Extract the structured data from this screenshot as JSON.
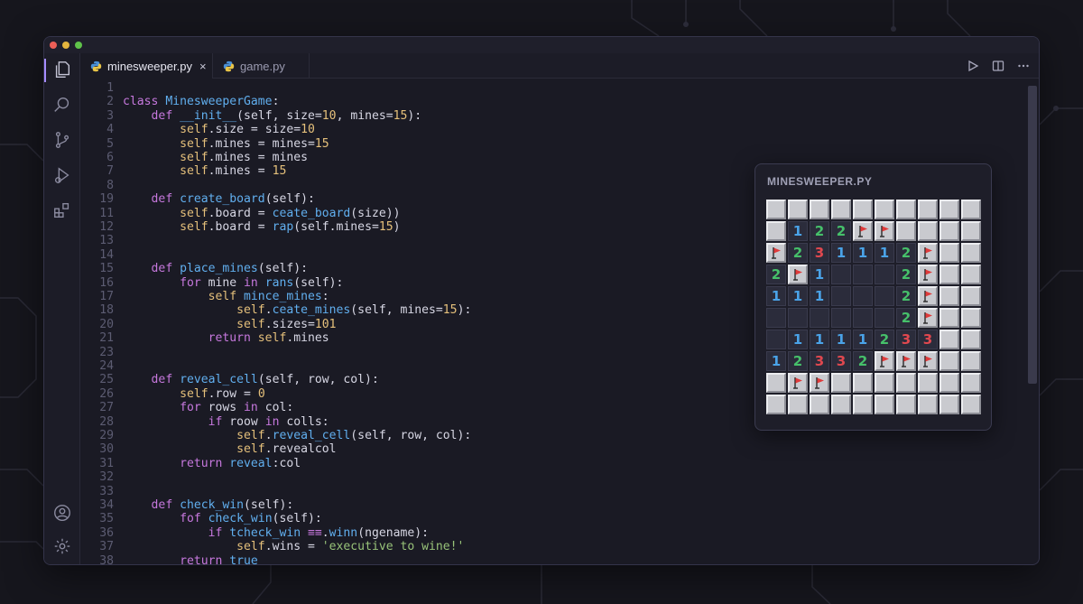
{
  "window": {
    "tabs": [
      {
        "label": "minesweeper.py",
        "active": true,
        "close": "×"
      },
      {
        "label": "game.py",
        "active": false
      }
    ],
    "tab_actions": [
      {
        "icon": "run-icon"
      },
      {
        "icon": "split-editor-icon"
      },
      {
        "icon": "more-icon"
      }
    ]
  },
  "activity_bar": {
    "top": [
      "explorer-icon",
      "search-icon",
      "source-control-icon",
      "run-debug-icon",
      "extensions-icon"
    ],
    "bottom": [
      "account-icon",
      "settings-gear-icon"
    ]
  },
  "editor": {
    "lines": [
      {
        "n": "1",
        "t": [
          {
            "c": "d",
            "s": ""
          }
        ]
      },
      {
        "n": "2",
        "t": [
          {
            "c": "k",
            "s": "class "
          },
          {
            "c": "f",
            "s": "MinesweeperGame"
          },
          {
            "c": "d",
            "s": ":"
          }
        ]
      },
      {
        "n": "3",
        "t": [
          {
            "c": "d",
            "s": "    "
          },
          {
            "c": "k",
            "s": "def "
          },
          {
            "c": "f",
            "s": "__init__"
          },
          {
            "c": "d",
            "s": "(self, size="
          },
          {
            "c": "n",
            "s": "10"
          },
          {
            "c": "d",
            "s": ", mines="
          },
          {
            "c": "n",
            "s": "15"
          },
          {
            "c": "d",
            "s": "):"
          }
        ]
      },
      {
        "n": "4",
        "t": [
          {
            "c": "d",
            "s": "        "
          },
          {
            "c": "y",
            "s": "self"
          },
          {
            "c": "d",
            "s": ".size = size="
          },
          {
            "c": "n",
            "s": "10"
          }
        ]
      },
      {
        "n": "5",
        "t": [
          {
            "c": "d",
            "s": "        "
          },
          {
            "c": "y",
            "s": "self"
          },
          {
            "c": "d",
            "s": ".mines = mines="
          },
          {
            "c": "n",
            "s": "15"
          }
        ]
      },
      {
        "n": "6",
        "t": [
          {
            "c": "d",
            "s": "        "
          },
          {
            "c": "y",
            "s": "self"
          },
          {
            "c": "d",
            "s": ".mines = mines"
          }
        ]
      },
      {
        "n": "7",
        "t": [
          {
            "c": "d",
            "s": "        "
          },
          {
            "c": "y",
            "s": "self"
          },
          {
            "c": "d",
            "s": ".mines = "
          },
          {
            "c": "n",
            "s": "15"
          }
        ]
      },
      {
        "n": "8",
        "t": [
          {
            "c": "d",
            "s": ""
          }
        ]
      },
      {
        "n": "19",
        "t": [
          {
            "c": "d",
            "s": "    "
          },
          {
            "c": "k",
            "s": "def "
          },
          {
            "c": "f",
            "s": "create_board"
          },
          {
            "c": "d",
            "s": "(self):"
          }
        ]
      },
      {
        "n": "11",
        "t": [
          {
            "c": "d",
            "s": "        "
          },
          {
            "c": "y",
            "s": "self"
          },
          {
            "c": "d",
            "s": ".board = "
          },
          {
            "c": "f",
            "s": "ceate_board"
          },
          {
            "c": "d",
            "s": "(size))"
          }
        ]
      },
      {
        "n": "12",
        "t": [
          {
            "c": "d",
            "s": "        "
          },
          {
            "c": "y",
            "s": "self"
          },
          {
            "c": "d",
            "s": ".board = "
          },
          {
            "c": "f",
            "s": "rap"
          },
          {
            "c": "d",
            "s": "(self.mines="
          },
          {
            "c": "n",
            "s": "15"
          },
          {
            "c": "d",
            "s": ")"
          }
        ]
      },
      {
        "n": "13",
        "t": [
          {
            "c": "d",
            "s": ""
          }
        ]
      },
      {
        "n": "14",
        "t": [
          {
            "c": "d",
            "s": ""
          }
        ]
      },
      {
        "n": "15",
        "t": [
          {
            "c": "d",
            "s": "    "
          },
          {
            "c": "k",
            "s": "def "
          },
          {
            "c": "f",
            "s": "place_mines"
          },
          {
            "c": "d",
            "s": "(self):"
          }
        ]
      },
      {
        "n": "16",
        "t": [
          {
            "c": "d",
            "s": "        "
          },
          {
            "c": "k",
            "s": "for "
          },
          {
            "c": "d",
            "s": "mine "
          },
          {
            "c": "k",
            "s": "in "
          },
          {
            "c": "f",
            "s": "rans"
          },
          {
            "c": "d",
            "s": "(self):"
          }
        ]
      },
      {
        "n": "17",
        "t": [
          {
            "c": "d",
            "s": "            "
          },
          {
            "c": "y",
            "s": "self "
          },
          {
            "c": "f",
            "s": "mince_mines"
          },
          {
            "c": "d",
            "s": ":"
          }
        ]
      },
      {
        "n": "18",
        "t": [
          {
            "c": "d",
            "s": "                "
          },
          {
            "c": "y",
            "s": "self"
          },
          {
            "c": "d",
            "s": "."
          },
          {
            "c": "f",
            "s": "ceate_mines"
          },
          {
            "c": "d",
            "s": "(self, mines="
          },
          {
            "c": "n",
            "s": "15"
          },
          {
            "c": "d",
            "s": "):"
          }
        ]
      },
      {
        "n": "20",
        "t": [
          {
            "c": "d",
            "s": "                "
          },
          {
            "c": "y",
            "s": "self"
          },
          {
            "c": "d",
            "s": ".sizes="
          },
          {
            "c": "n",
            "s": "101"
          }
        ]
      },
      {
        "n": "21",
        "t": [
          {
            "c": "d",
            "s": "            "
          },
          {
            "c": "k",
            "s": "return "
          },
          {
            "c": "y",
            "s": "self"
          },
          {
            "c": "d",
            "s": ".mines"
          }
        ]
      },
      {
        "n": "23",
        "t": [
          {
            "c": "d",
            "s": ""
          }
        ]
      },
      {
        "n": "24",
        "t": [
          {
            "c": "d",
            "s": ""
          }
        ]
      },
      {
        "n": "25",
        "t": [
          {
            "c": "d",
            "s": "    "
          },
          {
            "c": "k",
            "s": "def "
          },
          {
            "c": "f",
            "s": "reveal_cell"
          },
          {
            "c": "d",
            "s": "(self, row, col):"
          }
        ]
      },
      {
        "n": "26",
        "t": [
          {
            "c": "d",
            "s": "        "
          },
          {
            "c": "y",
            "s": "self"
          },
          {
            "c": "d",
            "s": ".row = "
          },
          {
            "c": "n",
            "s": "0"
          }
        ]
      },
      {
        "n": "27",
        "t": [
          {
            "c": "d",
            "s": "        "
          },
          {
            "c": "k",
            "s": "for "
          },
          {
            "c": "d",
            "s": "rows "
          },
          {
            "c": "k",
            "s": "in "
          },
          {
            "c": "d",
            "s": "col:"
          }
        ]
      },
      {
        "n": "28",
        "t": [
          {
            "c": "d",
            "s": "            "
          },
          {
            "c": "k",
            "s": "if "
          },
          {
            "c": "d",
            "s": "roow "
          },
          {
            "c": "k",
            "s": "in "
          },
          {
            "c": "d",
            "s": "colls:"
          }
        ]
      },
      {
        "n": "29",
        "t": [
          {
            "c": "d",
            "s": "                "
          },
          {
            "c": "y",
            "s": "self"
          },
          {
            "c": "d",
            "s": "."
          },
          {
            "c": "f",
            "s": "reveal_cell"
          },
          {
            "c": "d",
            "s": "(self, row, col):"
          }
        ]
      },
      {
        "n": "30",
        "t": [
          {
            "c": "d",
            "s": "                "
          },
          {
            "c": "y",
            "s": "self"
          },
          {
            "c": "d",
            "s": ".revealcol"
          }
        ]
      },
      {
        "n": "31",
        "t": [
          {
            "c": "d",
            "s": "        "
          },
          {
            "c": "k",
            "s": "return "
          },
          {
            "c": "f",
            "s": "reveal"
          },
          {
            "c": "d",
            "s": ":col"
          }
        ]
      },
      {
        "n": "32",
        "t": [
          {
            "c": "d",
            "s": ""
          }
        ]
      },
      {
        "n": "33",
        "t": [
          {
            "c": "d",
            "s": ""
          }
        ]
      },
      {
        "n": "34",
        "t": [
          {
            "c": "d",
            "s": "    "
          },
          {
            "c": "k",
            "s": "def "
          },
          {
            "c": "f",
            "s": "check_win"
          },
          {
            "c": "d",
            "s": "(self):"
          }
        ]
      },
      {
        "n": "35",
        "t": [
          {
            "c": "d",
            "s": "        "
          },
          {
            "c": "k",
            "s": "fof "
          },
          {
            "c": "f",
            "s": "check_win"
          },
          {
            "c": "d",
            "s": "(self):"
          }
        ]
      },
      {
        "n": "36",
        "t": [
          {
            "c": "d",
            "s": "            "
          },
          {
            "c": "k",
            "s": "if "
          },
          {
            "c": "f",
            "s": "tcheck_win "
          },
          {
            "c": "k",
            "s": "≡≡"
          },
          {
            "c": "d",
            "s": "."
          },
          {
            "c": "f",
            "s": "winn"
          },
          {
            "c": "d",
            "s": "(ngename):"
          }
        ]
      },
      {
        "n": "37",
        "t": [
          {
            "c": "d",
            "s": "                "
          },
          {
            "c": "y",
            "s": "self"
          },
          {
            "c": "d",
            "s": ".wins = "
          },
          {
            "c": "s",
            "s": "'executive to wine!'"
          }
        ]
      },
      {
        "n": "38",
        "t": [
          {
            "c": "d",
            "s": "        "
          },
          {
            "c": "k",
            "s": "return "
          },
          {
            "c": "f",
            "s": "true"
          }
        ]
      }
    ]
  },
  "minesweeper_panel": {
    "title": "MINESWEEPER.PY",
    "rows": [
      [
        "#",
        "#",
        "#",
        "#",
        "#",
        "#",
        "#",
        "#",
        "#",
        "#"
      ],
      [
        "#",
        "1",
        "2",
        "2",
        "F",
        "F",
        "#",
        "#",
        "#",
        "#"
      ],
      [
        "F",
        "2",
        "3",
        "1",
        "1",
        "1",
        "2",
        "F",
        "#",
        "#"
      ],
      [
        "2",
        "F",
        "1",
        ".",
        ".",
        ".",
        "2",
        "F",
        "#",
        "#"
      ],
      [
        "1",
        "1",
        "1",
        ".",
        ".",
        ".",
        "2",
        "F",
        "#",
        "#"
      ],
      [
        ".",
        ".",
        ".",
        ".",
        ".",
        ".",
        "2",
        "F",
        "#",
        "#"
      ],
      [
        ".",
        "1",
        "1",
        "1",
        "1",
        "2",
        "3",
        "3",
        "#",
        "#"
      ],
      [
        "1",
        "2",
        "3",
        "3",
        "2",
        "F",
        "F",
        "F",
        "#",
        "#"
      ],
      [
        "#",
        "F",
        "F",
        "#",
        "#",
        "#",
        "#",
        "#",
        "#",
        "#"
      ],
      [
        "#",
        "#",
        "#",
        "#",
        "#",
        "#",
        "#",
        "#",
        "#",
        "#"
      ]
    ]
  },
  "colors": {
    "keyword": "#c678dd",
    "function": "#61afef",
    "self": "#e5c07b",
    "number": "#e5c07b",
    "string": "#98c379",
    "default": "#d7d7e4",
    "n1": "#4aa3e8",
    "n2": "#46c06a",
    "n3": "#e0484f",
    "flag": "#e03a3a"
  }
}
